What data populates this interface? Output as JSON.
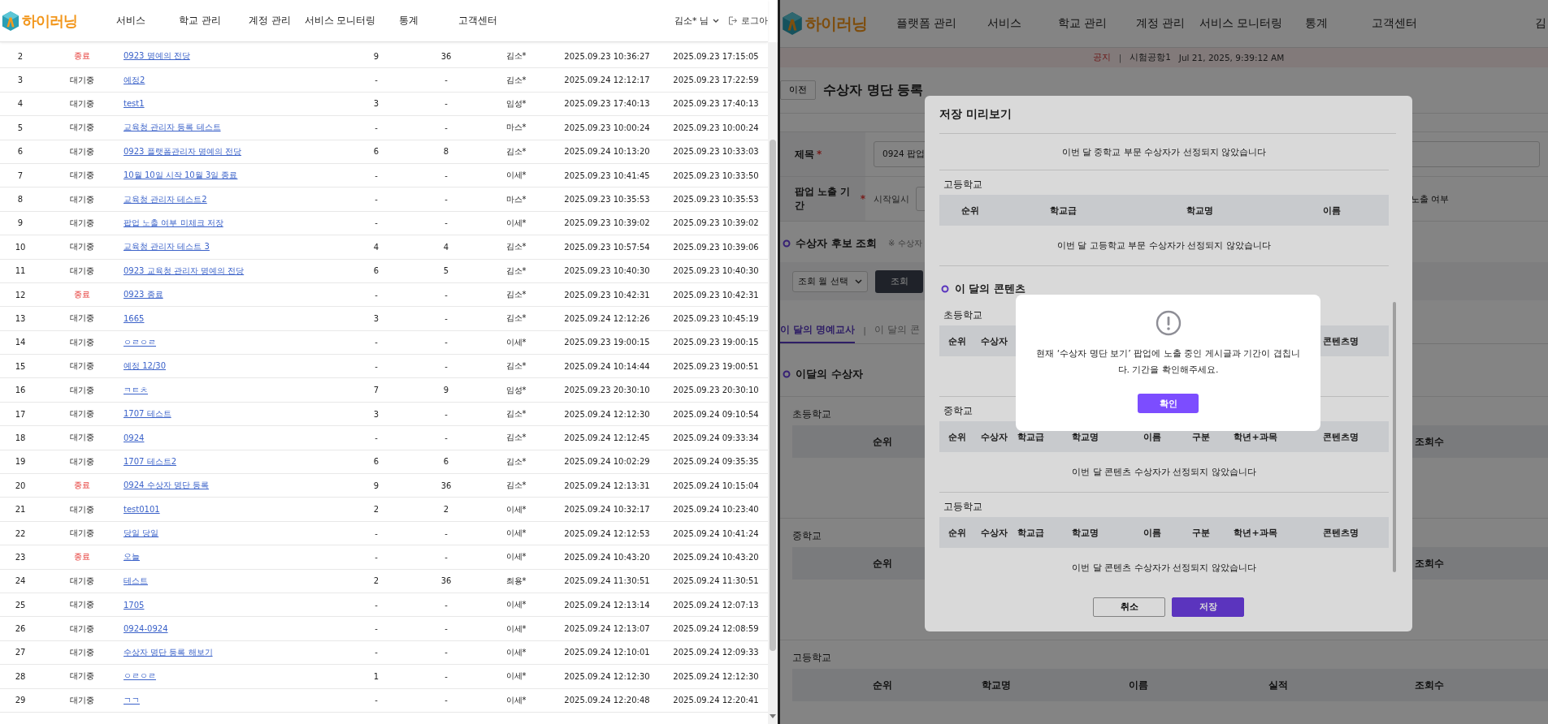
{
  "left_window": {
    "header": {
      "logo": "하이러닝",
      "nav": [
        "서비스",
        "학교 관리",
        "계정 관리",
        "서비스 모니터링",
        "통계",
        "고객센터"
      ],
      "user": "김소* 님",
      "logout": "로그아"
    },
    "rows": [
      {
        "cells": [
          "2",
          "종료",
          "0923 명예의 전당",
          "9",
          "36",
          "김소*",
          "2025.09.23 10:36:27",
          "2025.09.23 17:15:05"
        ],
        "ended": true
      },
      {
        "cells": [
          "3",
          "대기중",
          "예정2",
          "-",
          "-",
          "김소*",
          "2025.09.24 12:12:17",
          "2025.09.23 17:22:59"
        ],
        "ended": false
      },
      {
        "cells": [
          "4",
          "대기중",
          "test1",
          "3",
          "-",
          "임성*",
          "2025.09.23 17:40:13",
          "2025.09.23 17:40:13"
        ],
        "ended": false
      },
      {
        "cells": [
          "5",
          "대기중",
          "교육청 관리자 등록 테스트",
          "-",
          "-",
          "마스*",
          "2025.09.23 10:00:24",
          "2025.09.23 10:00:24"
        ],
        "ended": false
      },
      {
        "cells": [
          "6",
          "대기중",
          "0923 플랫폼관리자 명예의 전당",
          "6",
          "8",
          "김소*",
          "2025.09.24 10:13:20",
          "2025.09.23 10:33:03"
        ],
        "ended": false
      },
      {
        "cells": [
          "7",
          "대기중",
          "10월 10일 시작 10월 3일 종료",
          "-",
          "-",
          "이세*",
          "2025.09.23 10:41:45",
          "2025.09.23 10:33:50"
        ],
        "ended": false
      },
      {
        "cells": [
          "8",
          "대기중",
          "교육청 관리자 테스트2",
          "-",
          "-",
          "마스*",
          "2025.09.23 10:35:53",
          "2025.09.23 10:35:53"
        ],
        "ended": false
      },
      {
        "cells": [
          "9",
          "대기중",
          "팝업 노출 여부 미체크 저장",
          "-",
          "-",
          "이세*",
          "2025.09.23 10:39:02",
          "2025.09.23 10:39:02"
        ],
        "ended": false
      },
      {
        "cells": [
          "10",
          "대기중",
          "교육청 관리자 테스트 3",
          "4",
          "4",
          "김소*",
          "2025.09.23 10:57:54",
          "2025.09.23 10:39:06"
        ],
        "ended": false
      },
      {
        "cells": [
          "11",
          "대기중",
          "0923 교육청 관리자 명예의 전당",
          "6",
          "5",
          "김소*",
          "2025.09.23 10:40:30",
          "2025.09.23 10:40:30"
        ],
        "ended": false
      },
      {
        "cells": [
          "12",
          "종료",
          "0923 종료",
          "-",
          "-",
          "김소*",
          "2025.09.23 10:42:31",
          "2025.09.23 10:42:31"
        ],
        "ended": true
      },
      {
        "cells": [
          "13",
          "대기중",
          "1665",
          "3",
          "-",
          "김소*",
          "2025.09.24 12:12:26",
          "2025.09.23 10:45:19"
        ],
        "ended": false
      },
      {
        "cells": [
          "14",
          "대기중",
          "ㅇㄹㅇㄹ",
          "-",
          "-",
          "이세*",
          "2025.09.23 19:00:15",
          "2025.09.23 19:00:15"
        ],
        "ended": false
      },
      {
        "cells": [
          "15",
          "대기중",
          "예정 12/30",
          "-",
          "-",
          "김소*",
          "2025.09.24 10:14:44",
          "2025.09.23 19:00:51"
        ],
        "ended": false
      },
      {
        "cells": [
          "16",
          "대기중",
          "ㅋㅌㅊ",
          "7",
          "9",
          "임성*",
          "2025.09.23 20:30:10",
          "2025.09.23 20:30:10"
        ],
        "ended": false
      },
      {
        "cells": [
          "17",
          "대기중",
          "1707 테스트",
          "3",
          "-",
          "김소*",
          "2025.09.24 12:12:30",
          "2025.09.24 09:10:54"
        ],
        "ended": false
      },
      {
        "cells": [
          "18",
          "대기중",
          "0924",
          "-",
          "-",
          "김소*",
          "2025.09.24 12:12:45",
          "2025.09.24 09:33:34"
        ],
        "ended": false
      },
      {
        "cells": [
          "19",
          "대기중",
          "1707 테스트2",
          "6",
          "6",
          "김소*",
          "2025.09.24 10:02:29",
          "2025.09.24 09:35:35"
        ],
        "ended": false
      },
      {
        "cells": [
          "20",
          "종료",
          "0924 수상자 명단 등록",
          "9",
          "36",
          "김소*",
          "2025.09.24 12:13:31",
          "2025.09.24 10:15:04"
        ],
        "ended": true
      },
      {
        "cells": [
          "21",
          "대기중",
          "test0101",
          "2",
          "2",
          "이세*",
          "2025.09.24 10:32:17",
          "2025.09.24 10:23:40"
        ],
        "ended": false
      },
      {
        "cells": [
          "22",
          "대기중",
          "당일 당일",
          "-",
          "-",
          "이세*",
          "2025.09.24 12:12:53",
          "2025.09.24 10:41:24"
        ],
        "ended": false
      },
      {
        "cells": [
          "23",
          "종료",
          "오늘",
          "-",
          "-",
          "이세*",
          "2025.09.24 10:43:20",
          "2025.09.24 10:43:20"
        ],
        "ended": true
      },
      {
        "cells": [
          "24",
          "대기중",
          "테스트",
          "2",
          "36",
          "최용*",
          "2025.09.24 11:30:51",
          "2025.09.24 11:30:51"
        ],
        "ended": false
      },
      {
        "cells": [
          "25",
          "대기중",
          "1705",
          "-",
          "-",
          "이세*",
          "2025.09.24 12:13:14",
          "2025.09.24 12:07:13"
        ],
        "ended": false
      },
      {
        "cells": [
          "26",
          "대기중",
          "0924-0924",
          "-",
          "-",
          "이세*",
          "2025.09.24 12:13:07",
          "2025.09.24 12:08:59"
        ],
        "ended": false
      },
      {
        "cells": [
          "27",
          "대기중",
          "수상자 명단 등록 해보기",
          "-",
          "-",
          "이세*",
          "2025.09.24 12:10:01",
          "2025.09.24 12:09:33"
        ],
        "ended": false
      },
      {
        "cells": [
          "28",
          "대기중",
          "ㅇㄹㅇㄹ",
          "1",
          "-",
          "이세*",
          "2025.09.24 12:12:30",
          "2025.09.24 12:12:30"
        ],
        "ended": false
      },
      {
        "cells": [
          "29",
          "대기중",
          "ㄱㄱ",
          "-",
          "-",
          "이세*",
          "2025.09.24 12:20:48",
          "2025.09.24 12:20:41"
        ],
        "ended": false
      }
    ]
  },
  "right_window": {
    "header": {
      "logo": "하이러닝",
      "nav": [
        "플랫폼 관리",
        "서비스",
        "학교 관리",
        "계정 관리",
        "서비스 모니터링",
        "통계",
        "고객센터"
      ],
      "user": "김"
    },
    "notice": {
      "tag": "공지",
      "separator": "|",
      "text": "시험공항1",
      "time": "Jul 21, 2025, 9:39:12 AM"
    },
    "back_button": "이전",
    "page_title": "수상자 명단 등록",
    "form": [
      {
        "kind": "text",
        "label": "제목",
        "required_mark": "*",
        "value": "0924 팝업"
      },
      {
        "kind": "period",
        "label": "팝업 노출 기간",
        "required_mark": "*",
        "start_label": "시작일시",
        "exposure_label": "노출 여부"
      }
    ],
    "candidate_section": {
      "title": "수상자 후보 조회",
      "note": "※ 수상자",
      "month_select": "조회 월 선택",
      "search_button": "조회"
    },
    "tabs": [
      {
        "label": "이 달의 명예교사",
        "selected": true
      },
      {
        "label": "이 달의 콘",
        "selected": false
      }
    ],
    "tab_separator": "|",
    "winners_title": "이달의 수상자",
    "tables": [
      {
        "label": "초등학교",
        "columns": [
          "순위",
          "조회수"
        ]
      },
      {
        "label": "중학교",
        "columns": [
          "순위",
          "조회수"
        ]
      },
      {
        "label": "고등학교",
        "columns": [
          "순위",
          "학교명",
          "이름",
          "실적",
          "조회수"
        ]
      }
    ]
  },
  "preview_modal": {
    "title": "저장 미리보기",
    "blocks": [
      {
        "kind": "message",
        "text": "이번 달 중학교 부문 수상자가 선정되지 않았습니다"
      },
      {
        "kind": "award_table",
        "label": "고등학교",
        "columns": [
          "순위",
          "학교급",
          "학교명",
          "이름"
        ],
        "empty": "이번 달 고등학교 부문 수상자가 선정되지 않았습니다"
      },
      {
        "kind": "heading",
        "text": "이 달의 콘텐츠"
      },
      {
        "kind": "content_table",
        "label": "초등학교",
        "columns": [
          "순위",
          "수상자",
          "콘텐츠명"
        ]
      },
      {
        "kind": "content_table",
        "label": "중학교",
        "columns": [
          "순위",
          "수상자",
          "학교급",
          "학교명",
          "이름",
          "구분",
          "학년+과목",
          "콘텐츠명"
        ],
        "empty": "이번 달 콘텐츠 수상자가 선정되지 않았습니다"
      },
      {
        "kind": "content_table",
        "label": "고등학교",
        "columns": [
          "순위",
          "수상자",
          "학교급",
          "학교명",
          "이름",
          "구분",
          "학년+과목",
          "콘텐츠명"
        ],
        "empty": "이번 달 콘텐츠 수상자가 선정되지 않았습니다"
      }
    ],
    "buttons": [
      "취소",
      "저장"
    ]
  },
  "alert": {
    "message": "현재 ‘수상자 명단 보기’ 팝업에 노출 중인 게시글과 기간이 겹칩니다. 기간을 확인해주세요.",
    "confirm": "확인"
  }
}
